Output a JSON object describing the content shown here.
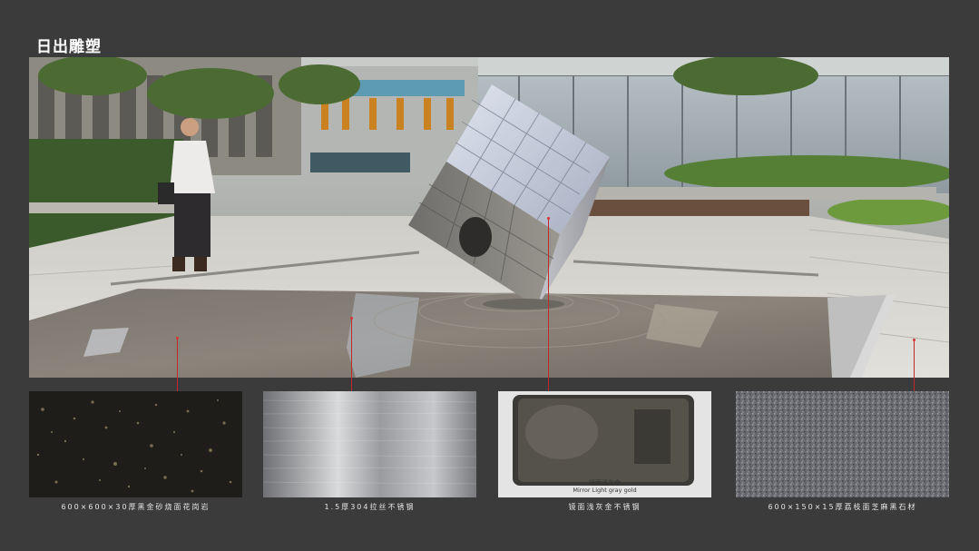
{
  "page": {
    "title": "日出雕塑"
  },
  "render": {
    "description_icon": "sculpture-render-image"
  },
  "materials": [
    {
      "caption": "600×600×30厚黑金砂烧面花岗岩",
      "swatch_icon": "black-gold-granite-swatch"
    },
    {
      "caption": "1.5厚304拉丝不锈钢",
      "swatch_icon": "brushed-steel-swatch"
    },
    {
      "caption": "镜面浅灰金不锈钢",
      "swatch_icon": "mirror-steel-swatch",
      "label_line1": "镜面浅灰金",
      "label_line2": "Mirror Light gray gold"
    },
    {
      "caption": "600×150×15厚荔枝面芝麻黑石材",
      "swatch_icon": "sesame-black-stone-swatch"
    }
  ],
  "colors": {
    "background": "#3b3b3b",
    "leader": "#c0282c",
    "caption": "#e6e6e6"
  }
}
